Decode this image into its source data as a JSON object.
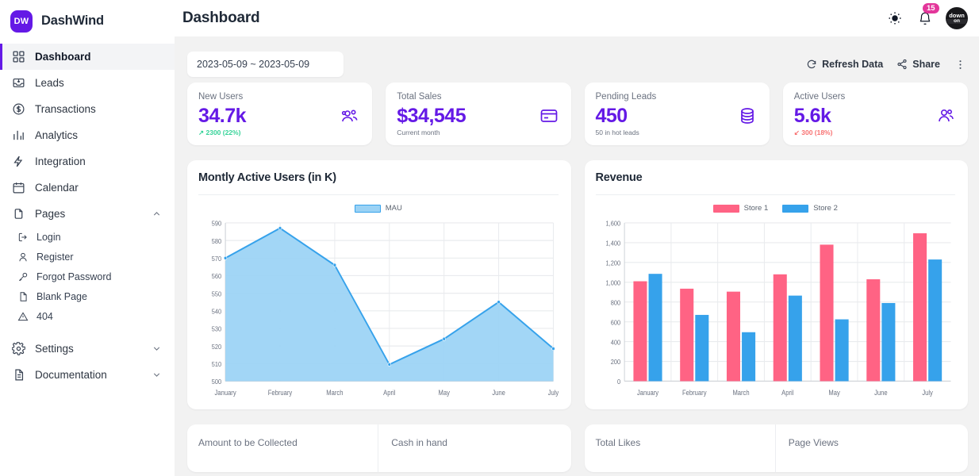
{
  "sidebar": {
    "brand": {
      "logo_text": "DW",
      "name": "DashWind"
    },
    "items": [
      {
        "label": "Dashboard",
        "icon": "grid-icon",
        "active": true
      },
      {
        "label": "Leads",
        "icon": "inbox-icon",
        "active": false
      },
      {
        "label": "Transactions",
        "icon": "dollar-circle-icon",
        "active": false
      },
      {
        "label": "Analytics",
        "icon": "bar-chart-icon",
        "active": false
      },
      {
        "label": "Integration",
        "icon": "bolt-icon",
        "active": false
      },
      {
        "label": "Calendar",
        "icon": "calendar-icon",
        "active": false
      },
      {
        "label": "Pages",
        "icon": "documents-icon",
        "active": false,
        "expanded": true
      }
    ],
    "pages_children": [
      {
        "label": "Login",
        "icon": "login-icon"
      },
      {
        "label": "Register",
        "icon": "user-icon"
      },
      {
        "label": "Forgot Password",
        "icon": "key-icon"
      },
      {
        "label": "Blank Page",
        "icon": "page-icon"
      },
      {
        "label": "404",
        "icon": "warning-triangle-icon"
      }
    ],
    "footer_items": [
      {
        "label": "Settings",
        "icon": "gear-icon",
        "expanded": false
      },
      {
        "label": "Documentation",
        "icon": "document-text-icon",
        "expanded": false
      }
    ]
  },
  "topbar": {
    "title": "Dashboard",
    "theme_icon": "sun-icon",
    "notification_icon": "bell-icon",
    "notification_count": "15",
    "avatar_line1": "down",
    "avatar_line2": "on"
  },
  "toolbar": {
    "date_range": "2023-05-09 ~ 2023-05-09",
    "refresh_label": "Refresh Data",
    "refresh_icon": "refresh-icon",
    "share_label": "Share",
    "share_icon": "share-icon",
    "more_icon": "kebab-menu-icon"
  },
  "stats": [
    {
      "title": "New Users",
      "value": "34.7k",
      "desc": "↗ 2300 (22%)",
      "trend": "up",
      "icon": "users-group-icon"
    },
    {
      "title": "Total Sales",
      "value": "$34,545",
      "desc": "Current month",
      "trend": "none",
      "icon": "credit-card-icon"
    },
    {
      "title": "Pending Leads",
      "value": "450",
      "desc": "50 in hot leads",
      "trend": "none",
      "icon": "database-icon"
    },
    {
      "title": "Active Users",
      "value": "5.6k",
      "desc": "↙ 300 (18%)",
      "trend": "down",
      "icon": "user-check-icon"
    }
  ],
  "colors": {
    "brand_purple": "#6419e6",
    "accent_pink": "#e3369a",
    "success_green": "#36d399",
    "danger_red": "#f87272",
    "line_blue": "#36a2eb",
    "bar_red": "#ff6384"
  },
  "chart_data": [
    {
      "type": "area",
      "title": "Montly Active Users (in K)",
      "categories": [
        "January",
        "February",
        "March",
        "April",
        "May",
        "June",
        "July"
      ],
      "series": [
        {
          "name": "MAU",
          "values": [
            570,
            587,
            566,
            509.5,
            524,
            545,
            518.5
          ],
          "color": "#36a2eb"
        }
      ],
      "legend": [
        "MAU"
      ],
      "legend_position": "top",
      "ylim": [
        500,
        590
      ],
      "yticks": [
        500,
        510,
        520,
        530,
        540,
        550,
        560,
        570,
        580,
        590
      ],
      "ytick_labels": [
        "500",
        "510",
        "520",
        "530",
        "540",
        "550",
        "560",
        "570",
        "580",
        "590"
      ],
      "xlabel": "",
      "ylabel": "",
      "grid": true
    },
    {
      "type": "bar",
      "title": "Revenue",
      "categories": [
        "January",
        "February",
        "March",
        "April",
        "May",
        "June",
        "July"
      ],
      "series": [
        {
          "name": "Store 1",
          "values": [
            1010,
            935,
            905,
            1080,
            1380,
            1030,
            1495
          ],
          "color": "#ff6384"
        },
        {
          "name": "Store 2",
          "values": [
            1085,
            670,
            495,
            865,
            625,
            790,
            1230
          ],
          "color": "#36a2eb"
        }
      ],
      "legend": [
        "Store 1",
        "Store 2"
      ],
      "legend_position": "top",
      "ylim": [
        0,
        1600
      ],
      "yticks": [
        0,
        200,
        400,
        600,
        800,
        1000,
        1200,
        1400,
        1600
      ],
      "ytick_labels": [
        "0",
        "200",
        "400",
        "600",
        "800",
        "1,000",
        "1,200",
        "1,400",
        "1,600"
      ],
      "xlabel": "",
      "ylabel": "",
      "grid": true
    }
  ],
  "bottom_cards": [
    {
      "left_label": "Amount to be Collected",
      "right_label": "Cash in hand"
    },
    {
      "left_label": "Total Likes",
      "right_label": "Page Views"
    }
  ]
}
